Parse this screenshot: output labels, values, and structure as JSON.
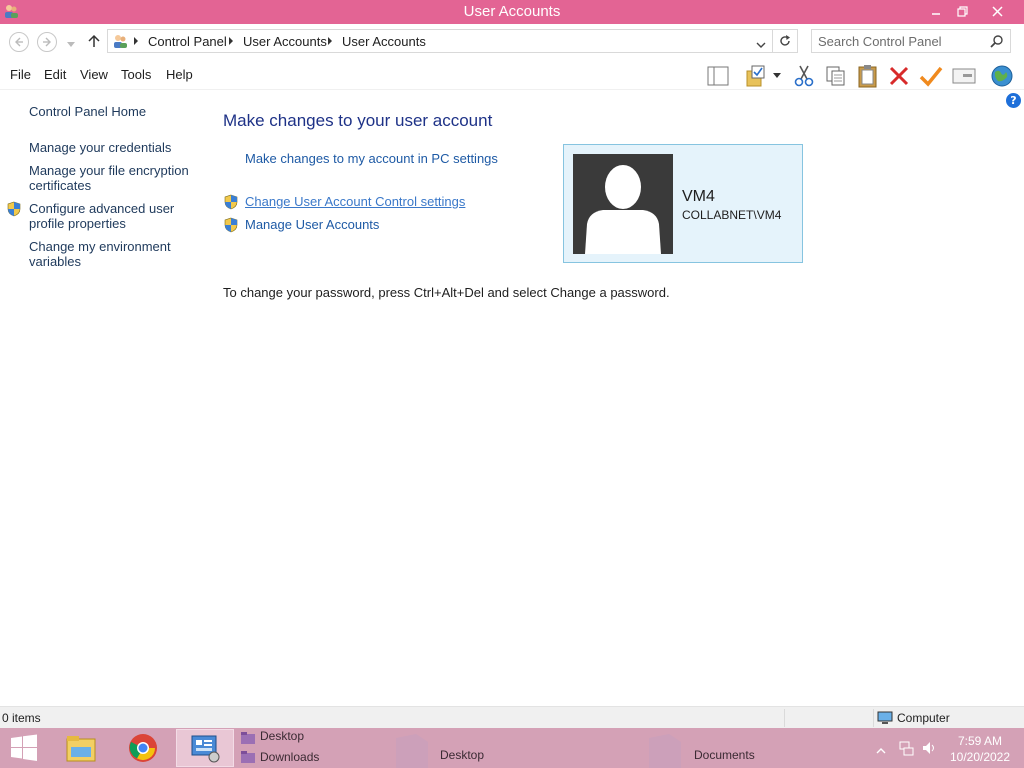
{
  "window": {
    "title": "User Accounts",
    "title_bar_color": "#e36494"
  },
  "address": {
    "breadcrumbs": [
      "Control Panel",
      "User Accounts",
      "User Accounts"
    ],
    "search_placeholder": "Search Control Panel"
  },
  "menu": {
    "items": [
      "File",
      "Edit",
      "View",
      "Tools",
      "Help"
    ]
  },
  "toolbar": {
    "icons": [
      "layout-icon",
      "folder-options-icon",
      "dropdown-icon",
      "cut-icon",
      "copy-icon",
      "paste-icon",
      "delete-icon",
      "checkmark-icon",
      "properties-icon",
      "globe-icon"
    ]
  },
  "sidebar": {
    "items": [
      {
        "label": "Control Panel Home"
      },
      {
        "label": "Manage your credentials"
      },
      {
        "label": "Manage your file encryption certificates"
      },
      {
        "label": "Configure advanced user profile properties",
        "icon": "shield-icon"
      },
      {
        "label": "Change my environment variables"
      }
    ]
  },
  "main": {
    "heading": "Make changes to your user account",
    "pc_settings_link": "Make changes to my account in PC settings",
    "uac_link": "Change User Account Control settings",
    "manage_link": "Manage User Accounts",
    "info": "To change your password, press Ctrl+Alt+Del and select Change a password."
  },
  "user": {
    "name": "VM4",
    "domain": "COLLABNET\\VM4"
  },
  "statusbar": {
    "items": "0 items",
    "location": "Computer"
  },
  "taskbar": {
    "jump_items": [
      "Desktop",
      "Downloads"
    ],
    "desktop_label": "Desktop",
    "documents_label": "Documents",
    "time": "7:59 AM",
    "date": "10/20/2022",
    "color": "#d4a1b6"
  }
}
